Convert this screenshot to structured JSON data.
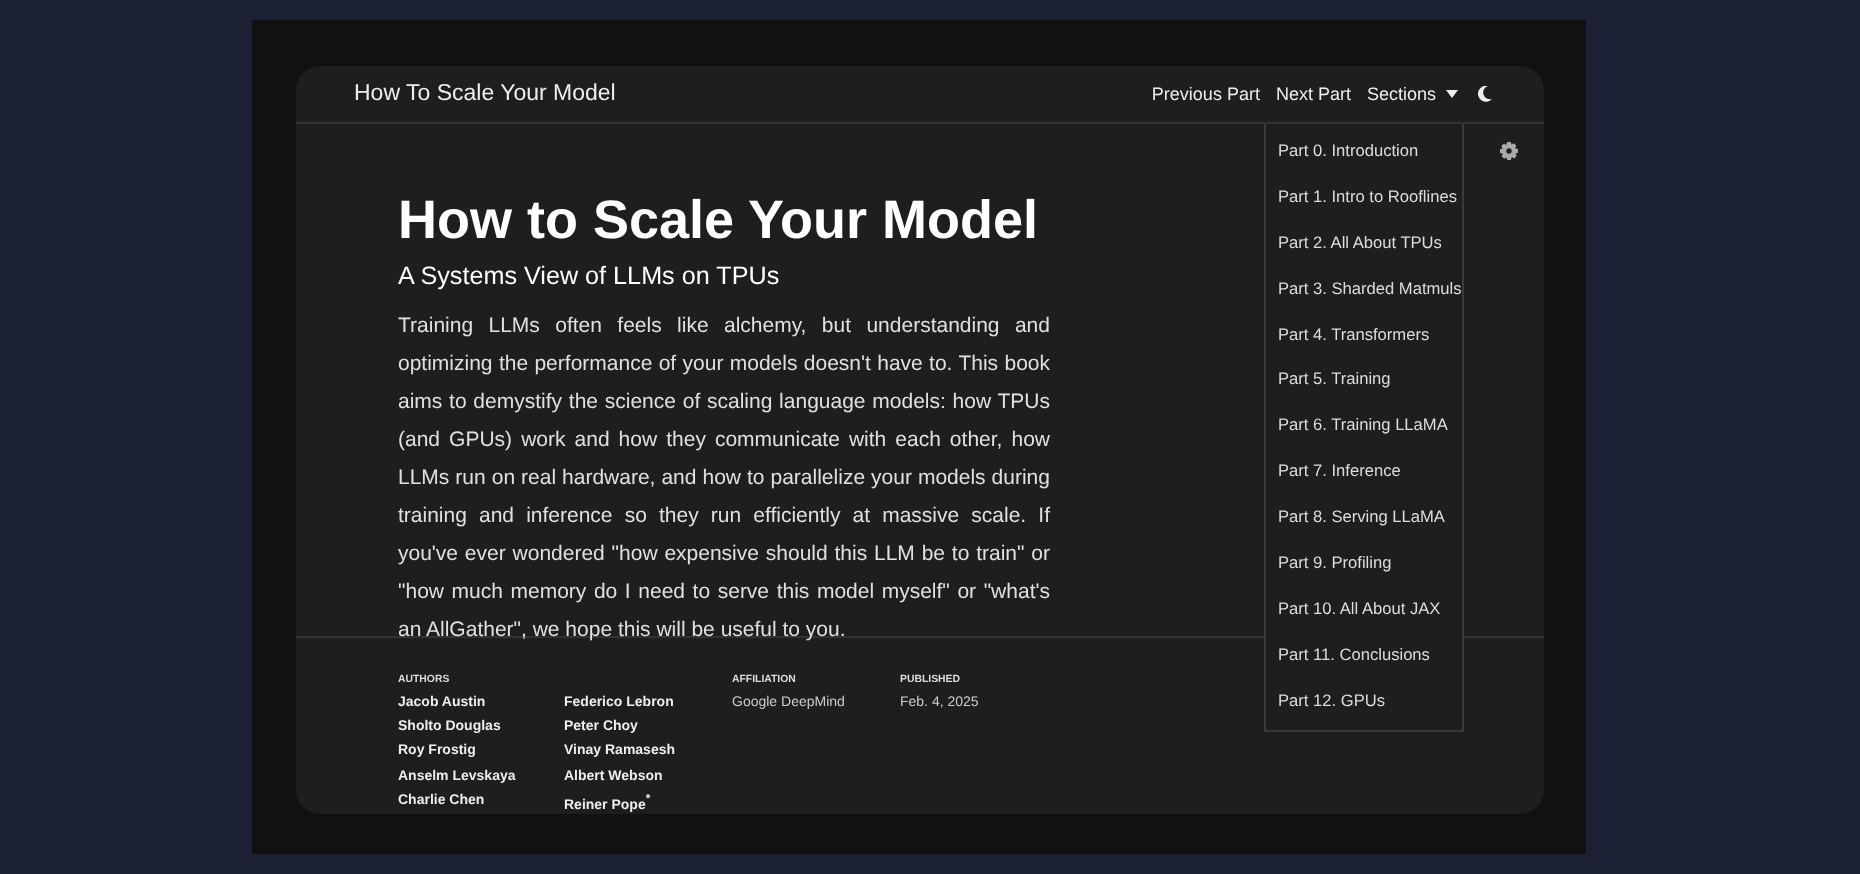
{
  "navbar": {
    "title": "How To Scale Your Model",
    "links": [
      "Previous Part",
      "Next Part"
    ],
    "sections_button": "Sections"
  },
  "sections_menu": [
    "Part 0. Introduction",
    "Part 1. Intro to Rooflines",
    "Part 2. All About TPUs",
    "Part 3. Sharded Matmuls",
    "Part 4. Transformers",
    "Part 5. Training",
    "Part 6. Training LLaMA",
    "Part 7. Inference",
    "Part 8. Serving LLaMA",
    "Part 9. Profiling",
    "Part 10. All About JAX",
    "Part 11. Conclusions",
    "Part 12. GPUs"
  ],
  "article": {
    "title": "How to Scale Your Model",
    "subtitle": "A Systems View of LLMs on TPUs",
    "intro": "Training LLMs often feels like alchemy, but understanding and optimizing the performance of your models doesn't have to. This book aims to demystify the science of scaling language models: how TPUs (and GPUs) work and how they communicate with each other, how LLMs run on real hardware, and how to parallelize your models during training and inference so they run efficiently at massive scale. If you've ever wondered \"how expensive should this LLM be to train\" or \"how much memory do I need to serve this model myself\" or \"what's an AllGather\", we hope this will be useful to you."
  },
  "byline": {
    "authors_label": "AUTHORS",
    "authors": [
      "Jacob Austin",
      "Sholto Douglas",
      "Roy Frostig",
      "Anselm Levskaya",
      "Charlie Chen",
      "Federico Lebron",
      "Peter Choy",
      "Vinay Ramasesh",
      "Albert Webson",
      "Reiner Pope$^{*}$"
    ],
    "affiliation_label": "AFFILIATION",
    "affiliation": "Google DeepMind",
    "published_label": "PUBLISHED",
    "published": "Feb. 4, 2025"
  }
}
